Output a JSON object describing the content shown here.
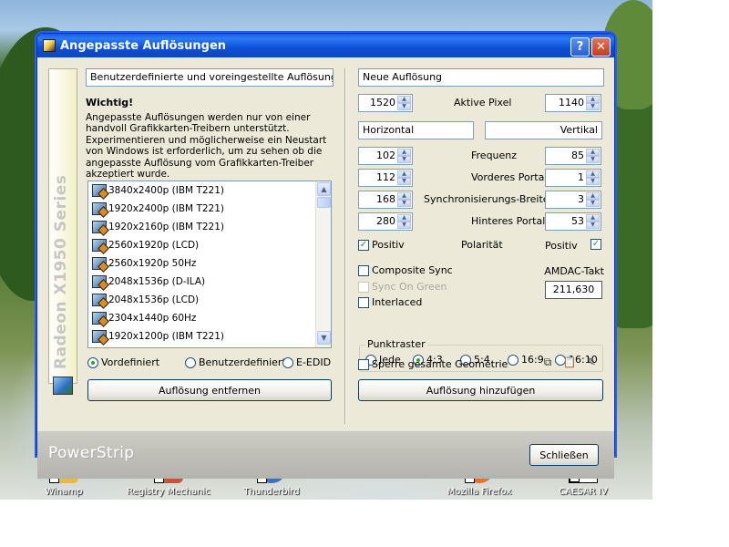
{
  "desktop": {
    "icons": [
      {
        "label": "Winamp",
        "icon": "winamp-icon",
        "color": "#f5b62b"
      },
      {
        "label": "Registry Mechanic",
        "icon": "registry-mechanic-icon",
        "color": "#d84b3b"
      },
      {
        "label": "Thunderbird",
        "icon": "thunderbird-icon",
        "color": "#3a6fd1"
      },
      {
        "label": "Mozilla Firefox",
        "icon": "firefox-icon",
        "color": "#e8741f"
      },
      {
        "label": "CAESAR IV",
        "icon": "caesar-icon",
        "color": "#ffffff"
      }
    ]
  },
  "window": {
    "title": "Angepasste Auflösungen",
    "help_label": "?",
    "close_label": "✕"
  },
  "brand_strip": {
    "text": "Radeon X1950 Series"
  },
  "left": {
    "description": "Benutzerdefinierte und voreingestellte Auflösungen",
    "important_heading": "Wichtig!",
    "important_text": "Angepasste Auflösungen werden nur von einer handvoll Grafikkarten-Treibern unterstützt. Experimentieren und möglicherweise ein Neustart von Windows ist erforderlich, um zu sehen ob die angepasste Auflösung vom Grafikkarten-Treiber akzeptiert wurde.",
    "resolutions": [
      "3840x2400p (IBM T221)",
      "1920x2400p (IBM T221)",
      "1920x2160p (IBM T221)",
      "2560x1920p (LCD)",
      "2560x1920p 50Hz",
      "2048x1536p (D-ILA)",
      "2048x1536p (LCD)",
      "2304x1440p 60Hz",
      "1920x1200p (IBM T221)"
    ],
    "radio_predefined": "Vordefiniert",
    "radio_custom": "Benutzerdefiniert",
    "radio_eedid": "E-EDID",
    "remove_button": "Auflösung entfernen"
  },
  "right": {
    "new_resolution": "Neue Auflösung",
    "active_pixel_label": "Aktive Pixel",
    "horizontal_value": "1520",
    "vertical_value": "1140",
    "horizontal_label": "Horizontal",
    "vertical_label": "Vertikal",
    "frequency_label": "Frequenz",
    "h_frequency": "102",
    "v_frequency": "85",
    "front_porch_label": "Vorderes Portal",
    "h_front_porch": "112",
    "v_front_porch": "1",
    "sync_width_label": "Synchronisierungs-Breite",
    "h_sync_width": "168",
    "v_sync_width": "3",
    "back_porch_label": "Hinteres Portal",
    "h_back_porch": "280",
    "v_back_porch": "53",
    "positive_left": "Positiv",
    "polarity_label": "Polarität",
    "positive_right": "Positiv",
    "composite_sync": "Composite Sync",
    "sync_on_green": "Sync On Green",
    "interlaced": "Interlaced",
    "ramdac_label": "RAMDAC-Takt",
    "ramdac_value": "211,630",
    "raster_title": "Punktraster",
    "raster_options": [
      "Jede",
      "4:3",
      "5:4",
      "16:9",
      "16:10"
    ],
    "lock_geometry": "Sperre gesamte Geometrie",
    "add_button": "Auflösung hinzufügen"
  },
  "footer": {
    "logo": "PowerStrip",
    "close_button": "Schließen"
  },
  "colors": {
    "titlebar": "#0a5fe6",
    "dialog_bg": "#ece9d8",
    "check_green": "#21a121"
  }
}
